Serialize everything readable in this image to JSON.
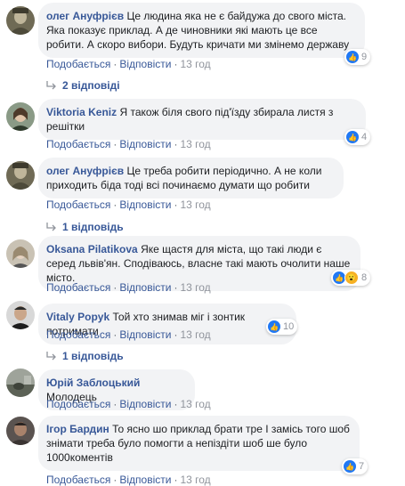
{
  "actions": {
    "like": "Подобається",
    "reply": "Відповісти",
    "sep": "·"
  },
  "comments": [
    {
      "author": "олег Ануфрієв",
      "text": "Це людина яка не є байдужа до свого міста. Яка показує приклад. А де чиновники які мають це все робити. А скоро вибори. Будуть кричати ми змінемо державу",
      "time": "13 год",
      "reactions": "9",
      "replies": "2 відповіді"
    },
    {
      "author": "Viktoria Keniz",
      "text": "Я також біля свого під'їзду збирала листя з решітки",
      "time": "13 год",
      "reactions": "4"
    },
    {
      "author": "олег Ануфрієв",
      "text": "Це треба робити періодично. А не коли приходить біда тоді всі починаємо думати що робити",
      "time": "13 год",
      "replies": "1 відповідь"
    },
    {
      "author": "Oksana Pilatikova",
      "text": "Яке щастя для міста, що такі люди є серед львів'ян. Сподіваюсь, власне такі мають очолити наше місто.",
      "time": "13 год",
      "reactions": "8"
    },
    {
      "author": "Vitaly Popyk",
      "text": "Той хто знимав міг і зонтик потримати",
      "time": "13 год",
      "reactions": "10",
      "replies": "1 відповідь"
    },
    {
      "author": "Юрій Заблоцький",
      "text": "Молодець",
      "time": "13 год"
    },
    {
      "author": "Ігор Бардин",
      "text": "То ясно шо приклад брати тре І замісь того шоб знімати треба було помогти а непіздіти шоб ше було 1000коментів",
      "time": "13 год",
      "reactions": "7"
    }
  ],
  "colors": {
    "link": "#385898",
    "bubble": "#f2f3f5",
    "like": "#2078f4",
    "muted": "#90949c"
  }
}
